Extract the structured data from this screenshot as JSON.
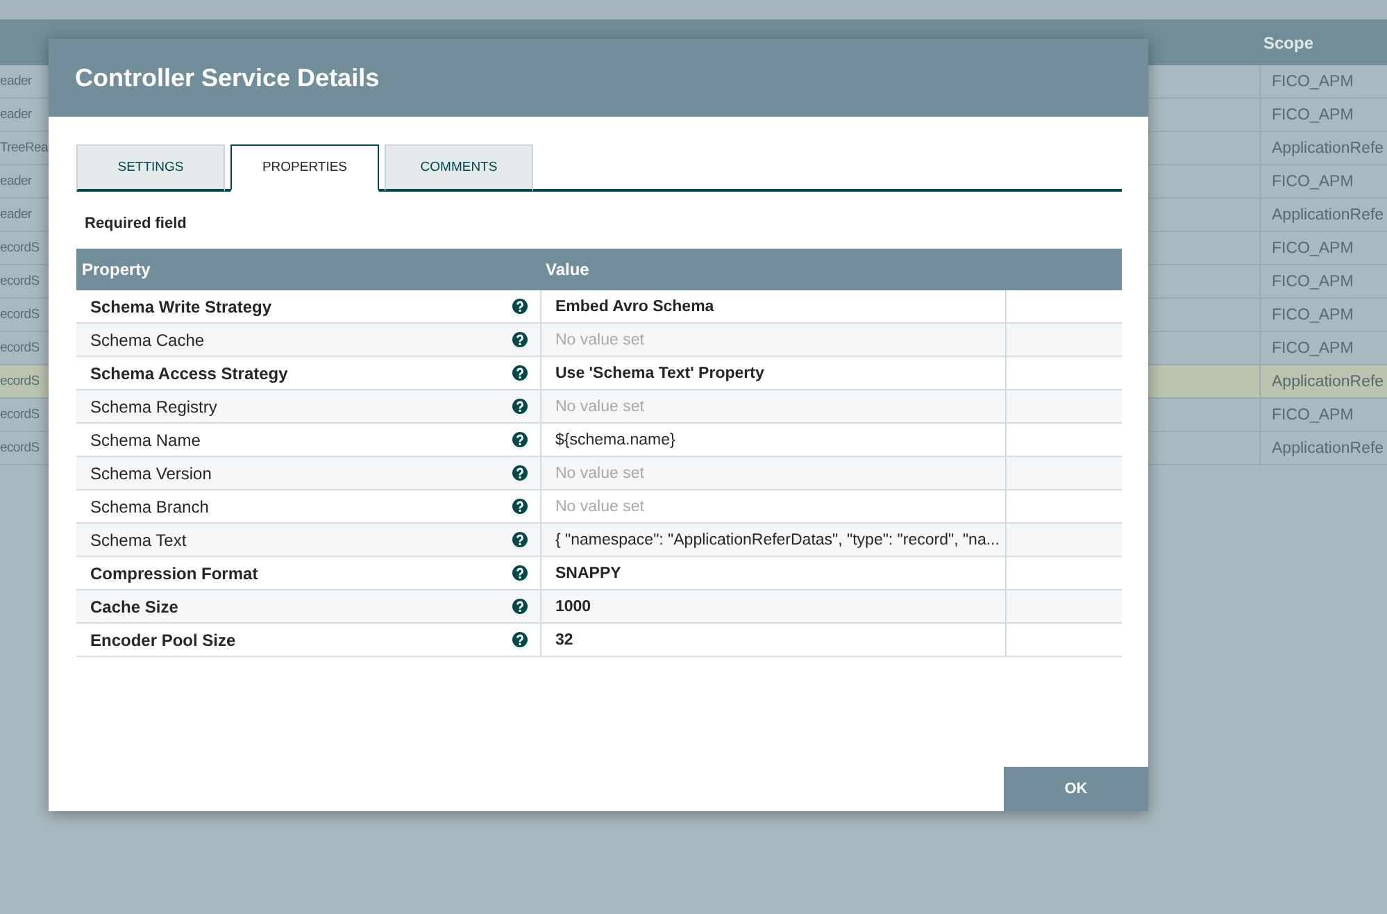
{
  "background_table": {
    "scope_header": "Scope",
    "rows": [
      {
        "column_1": "eader",
        "scope": "FICO_APM",
        "selected": false
      },
      {
        "column_1": "eader",
        "scope": "FICO_APM",
        "selected": false
      },
      {
        "column_1": "TreeRea",
        "scope": "ApplicationRefe",
        "selected": false
      },
      {
        "column_1": "eader",
        "scope": "FICO_APM",
        "selected": false
      },
      {
        "column_1": "eader",
        "scope": "ApplicationRefe",
        "selected": false
      },
      {
        "column_1": "ecordS",
        "scope": "FICO_APM",
        "selected": false
      },
      {
        "column_1": "ecordS",
        "scope": "FICO_APM",
        "selected": false
      },
      {
        "column_1": "ecordS",
        "scope": "FICO_APM",
        "selected": false
      },
      {
        "column_1": "ecordS",
        "scope": "FICO_APM",
        "selected": false
      },
      {
        "column_1": "ecordS",
        "scope": "ApplicationRefe",
        "selected": true
      },
      {
        "column_1": "ecordS",
        "scope": "FICO_APM",
        "selected": false
      },
      {
        "column_1": "ecordS",
        "scope": "ApplicationRefe",
        "selected": false
      }
    ]
  },
  "dialog": {
    "title": "Controller Service Details",
    "tabs": [
      {
        "label": "SETTINGS",
        "selected": false
      },
      {
        "label": "PROPERTIES",
        "selected": true
      },
      {
        "label": "COMMENTS",
        "selected": false
      }
    ],
    "required_note": "Required field",
    "properties_table": {
      "columns": [
        "Property",
        "Value"
      ],
      "rows": [
        {
          "property": "Schema Write Strategy",
          "value": "Embed Avro Schema",
          "required": true,
          "unset": false
        },
        {
          "property": "Schema Cache",
          "value": "No value set",
          "required": false,
          "unset": true
        },
        {
          "property": "Schema Access Strategy",
          "value": "Use 'Schema Text' Property",
          "required": true,
          "unset": false
        },
        {
          "property": "Schema Registry",
          "value": "No value set",
          "required": false,
          "unset": true
        },
        {
          "property": "Schema Name",
          "value": "${schema.name}",
          "required": false,
          "unset": false
        },
        {
          "property": "Schema Version",
          "value": "No value set",
          "required": false,
          "unset": true
        },
        {
          "property": "Schema Branch",
          "value": "No value set",
          "required": false,
          "unset": true
        },
        {
          "property": "Schema Text",
          "value": "{ \"namespace\": \"ApplicationReferDatas\", \"type\": \"record\", \"na...",
          "required": false,
          "unset": false
        },
        {
          "property": "Compression Format",
          "value": "SNAPPY",
          "required": true,
          "unset": false
        },
        {
          "property": "Cache Size",
          "value": "1000",
          "required": true,
          "unset": false
        },
        {
          "property": "Encoder Pool Size",
          "value": "32",
          "required": true,
          "unset": false
        }
      ]
    },
    "buttons": [
      {
        "label": "OK"
      }
    ]
  }
}
